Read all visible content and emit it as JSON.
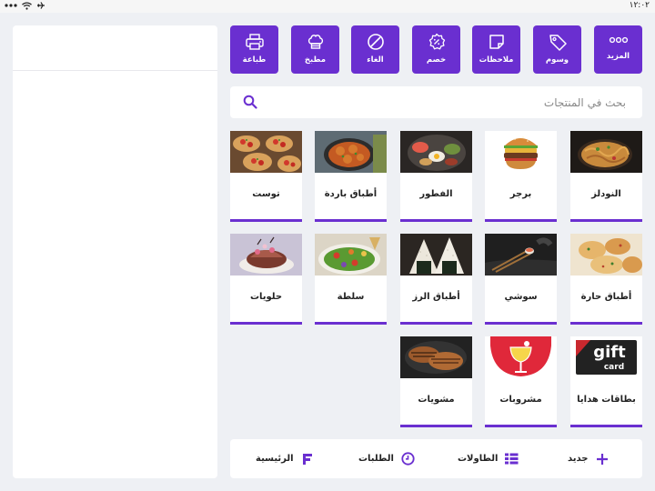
{
  "status_bar": {
    "time": "١٢:٠٢"
  },
  "colors": {
    "accent": "#6a2fd0",
    "background": "#eef0f4"
  },
  "toolbar": {
    "more": {
      "label": "المزيد",
      "icon": "ellipsis-icon"
    },
    "tags": {
      "label": "وسوم",
      "icon": "tag-icon"
    },
    "notes": {
      "label": "ملاحظات",
      "icon": "note-icon"
    },
    "discount": {
      "label": "خصم",
      "icon": "percent-badge-icon"
    },
    "cancel": {
      "label": "الغاء",
      "icon": "cancel-circle-icon"
    },
    "kitchen": {
      "label": "مطبخ",
      "icon": "chef-hat-icon"
    },
    "print": {
      "label": "طباعة",
      "icon": "printer-icon"
    }
  },
  "search": {
    "placeholder": "بحث في المنتجات"
  },
  "products": [
    {
      "name": "النودلز",
      "image": "noodles"
    },
    {
      "name": "برجر",
      "image": "burger"
    },
    {
      "name": "الفطور",
      "image": "breakfast"
    },
    {
      "name": "أطباق باردة",
      "image": "cold-dishes"
    },
    {
      "name": "توست",
      "image": "toast"
    },
    {
      "name": "أطباق حارة",
      "image": "hot-dishes"
    },
    {
      "name": "سوشي",
      "image": "sushi"
    },
    {
      "name": "أطباق الرز",
      "image": "rice-dishes"
    },
    {
      "name": "سلطة",
      "image": "salad"
    },
    {
      "name": "حلويات",
      "image": "desserts"
    },
    {
      "name": "بطاقات هدايا",
      "image": "gift-card"
    },
    {
      "name": "مشروبات",
      "image": "drinks"
    },
    {
      "name": "مشويات",
      "image": "grills"
    }
  ],
  "gift_card_image_text": [
    "gift",
    "card"
  ],
  "bottom_nav": {
    "new": {
      "label": "جديد",
      "icon": "plus-icon"
    },
    "tables": {
      "label": "الطاولات",
      "icon": "tables-icon"
    },
    "orders": {
      "label": "الطلبات",
      "icon": "clock-icon"
    },
    "home": {
      "label": "الرئيسية",
      "icon": "logo-icon"
    }
  }
}
